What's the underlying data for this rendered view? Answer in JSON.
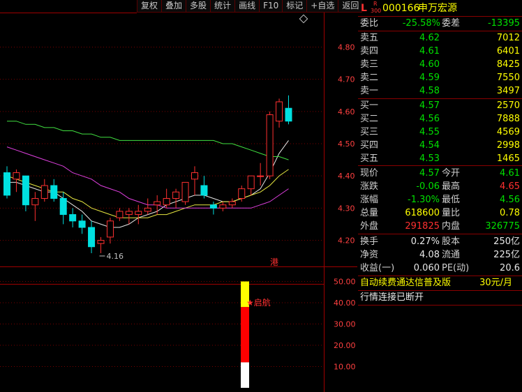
{
  "toolbar": [
    "复权",
    "叠加",
    "多股",
    "统计",
    "画线",
    "F10",
    "标记",
    "+自选",
    "返回"
  ],
  "stock": {
    "market_letter": "L",
    "badge_top": "R",
    "badge_bottom": "300",
    "code": "000166",
    "name": "申万宏源"
  },
  "ratio": {
    "label1": "委比",
    "value1": "-25.58%",
    "label2": "委差",
    "value2": "-13395"
  },
  "asks": [
    {
      "label": "卖五",
      "price": "4.62",
      "volume": "7012"
    },
    {
      "label": "卖四",
      "price": "4.61",
      "volume": "6401"
    },
    {
      "label": "卖三",
      "price": "4.60",
      "volume": "8425"
    },
    {
      "label": "卖二",
      "price": "4.59",
      "volume": "7550"
    },
    {
      "label": "卖一",
      "price": "4.58",
      "volume": "3497"
    }
  ],
  "bids": [
    {
      "label": "买一",
      "price": "4.57",
      "volume": "2570"
    },
    {
      "label": "买二",
      "price": "4.56",
      "volume": "7888"
    },
    {
      "label": "买三",
      "price": "4.55",
      "volume": "4569"
    },
    {
      "label": "买四",
      "price": "4.54",
      "volume": "2998"
    },
    {
      "label": "买五",
      "price": "4.53",
      "volume": "1465"
    }
  ],
  "quote": [
    {
      "l1": "现价",
      "v1": "4.57",
      "c1": "green",
      "l2": "今开",
      "v2": "4.61",
      "c2": "green"
    },
    {
      "l1": "涨跌",
      "v1": "-0.06",
      "c1": "green",
      "l2": "最高",
      "v2": "4.65",
      "c2": "red"
    },
    {
      "l1": "涨幅",
      "v1": "-1.30%",
      "c1": "green",
      "l2": "最低",
      "v2": "4.56",
      "c2": "green"
    },
    {
      "l1": "总量",
      "v1": "618600",
      "c1": "yellow",
      "l2": "量比",
      "v2": "0.78",
      "c2": "yellow"
    },
    {
      "l1": "外盘",
      "v1": "291825",
      "c1": "red",
      "l2": "内盘",
      "v2": "326775",
      "c2": "green"
    }
  ],
  "fundamentals": [
    {
      "l1": "换手",
      "v1": "0.27%",
      "l2": "股本",
      "v2": "250亿"
    },
    {
      "l1": "净资",
      "v1": "4.08",
      "l2": "流通",
      "v2": "225亿"
    },
    {
      "l1": "收益(一)",
      "v1": "0.060",
      "l2": "PE(动)",
      "v2": "20.6"
    }
  ],
  "ad": {
    "text": "自动续费通达信普及版",
    "price": "30元/月"
  },
  "status": "行情连接已断开",
  "chart_data": [
    {
      "type": "candlestick",
      "y_axis_labels": [
        "4.80",
        "4.70",
        "4.60",
        "4.50",
        "4.40",
        "4.30",
        "4.20"
      ],
      "ylim": [
        4.16,
        4.85
      ],
      "low_annotation": "4.16",
      "marker_label": "港",
      "ohlc": [
        [
          4.41,
          4.43,
          4.33,
          4.34
        ],
        [
          4.39,
          4.42,
          4.35,
          4.41
        ],
        [
          4.4,
          4.4,
          4.29,
          4.31
        ],
        [
          4.31,
          4.35,
          4.26,
          4.33
        ],
        [
          4.33,
          4.39,
          4.32,
          4.37
        ],
        [
          4.37,
          4.39,
          4.32,
          4.33
        ],
        [
          4.33,
          4.35,
          4.25,
          4.28
        ],
        [
          4.28,
          4.3,
          4.24,
          4.26
        ],
        [
          4.26,
          4.28,
          4.22,
          4.24
        ],
        [
          4.24,
          4.26,
          4.16,
          4.18
        ],
        [
          4.19,
          4.21,
          4.16,
          4.2
        ],
        [
          4.21,
          4.27,
          4.19,
          4.26
        ],
        [
          4.27,
          4.3,
          4.26,
          4.29
        ],
        [
          4.28,
          4.3,
          4.25,
          4.29
        ],
        [
          4.28,
          4.31,
          4.25,
          4.29
        ],
        [
          4.29,
          4.33,
          4.28,
          4.3
        ],
        [
          4.31,
          4.34,
          4.28,
          4.32
        ],
        [
          4.31,
          4.36,
          4.3,
          4.33
        ],
        [
          4.33,
          4.36,
          4.3,
          4.35
        ],
        [
          4.32,
          4.38,
          4.31,
          4.38
        ],
        [
          4.39,
          4.43,
          4.34,
          4.41
        ],
        [
          4.37,
          4.4,
          4.33,
          4.34
        ],
        [
          4.31,
          4.32,
          4.28,
          4.3
        ],
        [
          4.3,
          4.32,
          4.29,
          4.31
        ],
        [
          4.31,
          4.33,
          4.3,
          4.32
        ],
        [
          4.33,
          4.37,
          4.32,
          4.36
        ],
        [
          4.36,
          4.4,
          4.34,
          4.4
        ],
        [
          4.4,
          4.44,
          4.37,
          4.4
        ],
        [
          4.4,
          4.6,
          4.39,
          4.59
        ],
        [
          4.57,
          4.64,
          4.55,
          4.63
        ],
        [
          4.61,
          4.65,
          4.56,
          4.57
        ]
      ],
      "ma_lines": [
        {
          "color": "#e8e8e8",
          "values": [
            4.38,
            4.38,
            4.37,
            4.36,
            4.35,
            4.35,
            4.33,
            4.31,
            4.29,
            4.26,
            4.25,
            4.24,
            4.24,
            4.25,
            4.27,
            4.28,
            4.29,
            4.31,
            4.32,
            4.33,
            4.34,
            4.34,
            4.33,
            4.32,
            4.32,
            4.33,
            4.34,
            4.36,
            4.41,
            4.47,
            4.51
          ]
        },
        {
          "color": "#e8e840",
          "values": [
            4.4,
            4.39,
            4.38,
            4.37,
            4.36,
            4.35,
            4.35,
            4.33,
            4.32,
            4.3,
            4.29,
            4.28,
            4.27,
            4.27,
            4.27,
            4.27,
            4.28,
            4.28,
            4.29,
            4.3,
            4.31,
            4.31,
            4.31,
            4.32,
            4.32,
            4.33,
            4.34,
            4.35,
            4.37,
            4.4,
            4.42
          ]
        },
        {
          "color": "#e040e0",
          "values": [
            4.49,
            4.48,
            4.47,
            4.46,
            4.45,
            4.44,
            4.43,
            4.41,
            4.4,
            4.39,
            4.37,
            4.36,
            4.35,
            4.33,
            4.32,
            4.31,
            4.31,
            4.3,
            4.3,
            4.3,
            4.3,
            4.3,
            4.3,
            4.3,
            4.3,
            4.3,
            4.3,
            4.31,
            4.32,
            4.34,
            4.36
          ]
        },
        {
          "color": "#40e040",
          "values": [
            4.57,
            4.57,
            4.56,
            4.56,
            4.55,
            4.55,
            4.54,
            4.54,
            4.53,
            4.53,
            4.52,
            4.52,
            4.51,
            4.51,
            4.51,
            4.51,
            4.51,
            4.51,
            4.51,
            4.51,
            4.51,
            4.51,
            4.51,
            4.5,
            4.5,
            4.49,
            4.48,
            4.47,
            4.46,
            4.46,
            4.45
          ]
        }
      ]
    },
    {
      "type": "bar",
      "y_axis_labels": [
        "50.00",
        "40.00",
        "30.00",
        "20.00",
        "10.00"
      ],
      "ylim": [
        0,
        55
      ],
      "annotation": "★启航",
      "segments": [
        {
          "color": "#ffffff",
          "from": 0,
          "to": 12
        },
        {
          "color": "#ff0000",
          "from": 12,
          "to": 38
        },
        {
          "color": "#ffff00",
          "from": 38,
          "to": 50
        }
      ]
    }
  ]
}
